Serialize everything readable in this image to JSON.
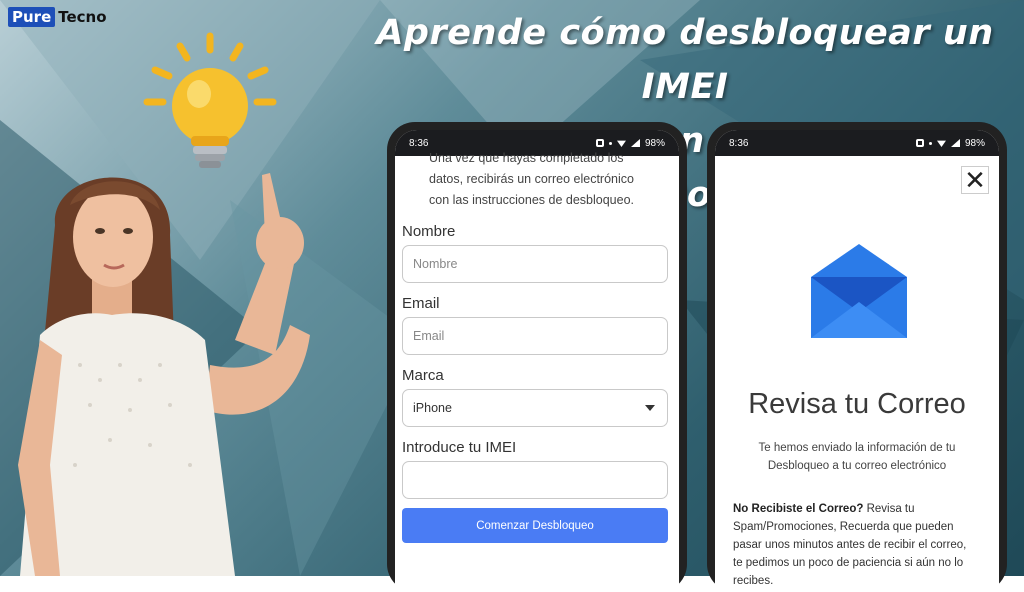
{
  "logo": {
    "part1": "Pure",
    "part2": "Tecno"
  },
  "headline": {
    "line1": "Aprende cómo desbloquear un IMEI",
    "line2": "reportado con la ayuda de ESNDoctor"
  },
  "phone_left": {
    "status": {
      "time": "8:36",
      "battery": "98%"
    },
    "intro_text": [
      "Una vez que hayas completado los",
      "datos, recibirás un correo electrónico",
      "con las instrucciones de desbloqueo."
    ],
    "form": {
      "name_label": "Nombre",
      "name_placeholder": "Nombre",
      "email_label": "Email",
      "email_placeholder": "Email",
      "brand_label": "Marca",
      "brand_selected": "iPhone",
      "imei_label": "Introduce tu IMEI",
      "imei_value": "",
      "submit_label": "Comenzar Desbloqueo"
    }
  },
  "phone_right": {
    "status": {
      "time": "8:36",
      "battery": "98%"
    },
    "close_label": "✕",
    "title": "Revisa tu Correo",
    "subtitle_line1": "Te hemos enviado la información de tu",
    "subtitle_line2": "Desbloqueo a tu correo electrónico",
    "help_bold": "No Recibiste el Correo?",
    "help_text_1": " Revisa tu",
    "help_text_2": "Spam/Promociones, Recuerda que pueden",
    "help_text_3": "pasar unos minutos antes de recibir el correo,",
    "help_text_4": "te pedimos un poco de paciencia si aún no lo",
    "help_text_5": "recibes."
  },
  "colors": {
    "brand_blue": "#1d4fb8",
    "button_blue": "#4a7cf4",
    "envelope_blue": "#2b7be8"
  },
  "icons": [
    "lightbulb-icon",
    "envelope-icon",
    "close-icon",
    "dropdown-caret-icon",
    "wifi-icon",
    "signal-icon",
    "battery-icon"
  ]
}
